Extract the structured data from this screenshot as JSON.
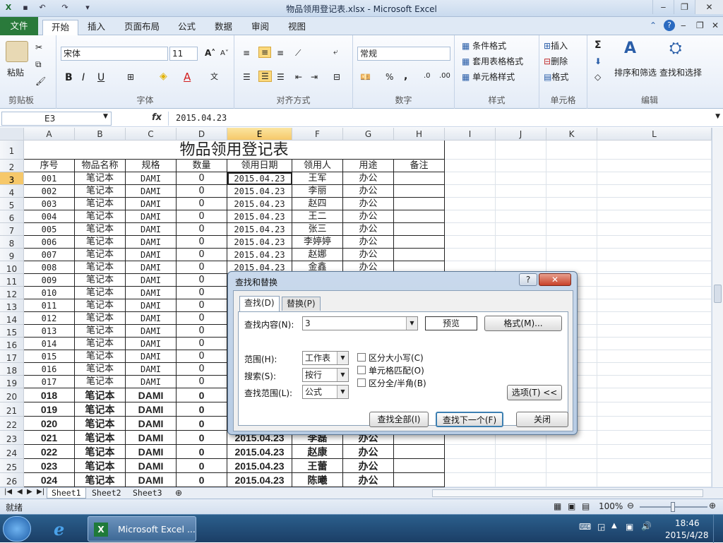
{
  "window": {
    "title": "物品领用登记表.xlsx - Microsoft Excel"
  },
  "tabs": [
    "文件",
    "开始",
    "插入",
    "页面布局",
    "公式",
    "数据",
    "审阅",
    "视图"
  ],
  "ribbon": {
    "clipboard": {
      "label": "剪贴板",
      "paste": "粘贴"
    },
    "font": {
      "label": "字体",
      "name": "宋体",
      "size": "11"
    },
    "align": {
      "label": "对齐方式"
    },
    "number": {
      "label": "数字",
      "format": "常规",
      "pct": "%",
      "comma": ","
    },
    "styles": {
      "label": "样式",
      "items": [
        "条件格式",
        "套用表格格式",
        "单元格样式"
      ]
    },
    "cells": {
      "label": "单元格",
      "items": [
        "插入",
        "删除",
        "格式"
      ]
    },
    "edit": {
      "label": "编辑",
      "sort": "排序和筛选",
      "find": "查找和选择",
      "sigma": "Σ"
    }
  },
  "formula_bar": {
    "cell": "E3",
    "fx": "fx",
    "value": "2015.04.23"
  },
  "columns": [
    "A",
    "B",
    "C",
    "D",
    "E",
    "F",
    "G",
    "H",
    "I",
    "J",
    "K",
    "L"
  ],
  "sheet": {
    "title": "物品领用登记表",
    "headers": [
      "序号",
      "物品名称",
      "规格",
      "数量",
      "领用日期",
      "领用人",
      "用途",
      "备注"
    ],
    "rows": [
      [
        "001",
        "笔记本",
        "DAMI",
        "0",
        "2015.04.23",
        "王军",
        "办公"
      ],
      [
        "002",
        "笔记本",
        "DAMI",
        "0",
        "2015.04.23",
        "李丽",
        "办公"
      ],
      [
        "003",
        "笔记本",
        "DAMI",
        "0",
        "2015.04.23",
        "赵四",
        "办公"
      ],
      [
        "004",
        "笔记本",
        "DAMI",
        "0",
        "2015.04.23",
        "王二",
        "办公"
      ],
      [
        "005",
        "笔记本",
        "DAMI",
        "0",
        "2015.04.23",
        "张三",
        "办公"
      ],
      [
        "006",
        "笔记本",
        "DAMI",
        "0",
        "2015.04.23",
        "李婷婷",
        "办公"
      ],
      [
        "007",
        "笔记本",
        "DAMI",
        "0",
        "2015.04.23",
        "赵娜",
        "办公"
      ],
      [
        "008",
        "笔记本",
        "DAMI",
        "0",
        "2015.04.23",
        "金鑫",
        "办公"
      ],
      [
        "009",
        "笔记本",
        "DAMI",
        "0",
        "",
        "",
        ""
      ],
      [
        "010",
        "笔记本",
        "DAMI",
        "0",
        "",
        "",
        ""
      ],
      [
        "011",
        "笔记本",
        "DAMI",
        "0",
        "",
        "",
        ""
      ],
      [
        "012",
        "笔记本",
        "DAMI",
        "0",
        "",
        "",
        ""
      ],
      [
        "013",
        "笔记本",
        "DAMI",
        "0",
        "",
        "",
        ""
      ],
      [
        "014",
        "笔记本",
        "DAMI",
        "0",
        "",
        "",
        ""
      ],
      [
        "015",
        "笔记本",
        "DAMI",
        "0",
        "",
        "",
        ""
      ],
      [
        "016",
        "笔记本",
        "DAMI",
        "0",
        "",
        "",
        ""
      ],
      [
        "017",
        "笔记本",
        "DAMI",
        "0",
        "",
        "",
        ""
      ],
      [
        "018",
        "笔记本",
        "DAMI",
        "0",
        "",
        "",
        ""
      ],
      [
        "019",
        "笔记本",
        "DAMI",
        "0",
        "",
        "",
        ""
      ],
      [
        "020",
        "笔记本",
        "DAMI",
        "0",
        "",
        "",
        ""
      ],
      [
        "021",
        "笔记本",
        "DAMI",
        "0",
        "2015.04.23",
        "李磊",
        "办公"
      ],
      [
        "022",
        "笔记本",
        "DAMI",
        "0",
        "2015.04.23",
        "赵康",
        "办公"
      ],
      [
        "023",
        "笔记本",
        "DAMI",
        "0",
        "2015.04.23",
        "王蕾",
        "办公"
      ],
      [
        "024",
        "笔记本",
        "DAMI",
        "0",
        "2015.04.23",
        "陈曦",
        "办公"
      ]
    ]
  },
  "sheet_tabs": [
    "Sheet1",
    "Sheet2",
    "Sheet3"
  ],
  "status": {
    "ready": "就绪",
    "zoom": "100%"
  },
  "dialog": {
    "title": "查找和替换",
    "help": "?",
    "close_x": "✕",
    "tab_find": "查找(D)",
    "tab_replace": "替换(P)",
    "find_label": "查找内容(N):",
    "find_value": "3",
    "preview": "预览",
    "format_btn": "格式(M)...",
    "scope_label": "范围(H):",
    "scope_value": "工作表",
    "search_label": "搜索(S):",
    "search_value": "按行",
    "lookin_label": "查找范围(L):",
    "lookin_value": "公式",
    "opt_case": "区分大小写(C)",
    "opt_cell": "单元格匹配(O)",
    "opt_width": "区分全/半角(B)",
    "options_btn": "选项(T) <<",
    "find_all": "查找全部(I)",
    "find_next": "查找下一个(F)",
    "close": "关闭"
  },
  "taskbar": {
    "app": "Microsoft Excel ...",
    "time": "18:46",
    "date": "2015/4/28"
  },
  "colors": {
    "file_tab": "#2a7a3b",
    "accent": "#f6c86a"
  }
}
